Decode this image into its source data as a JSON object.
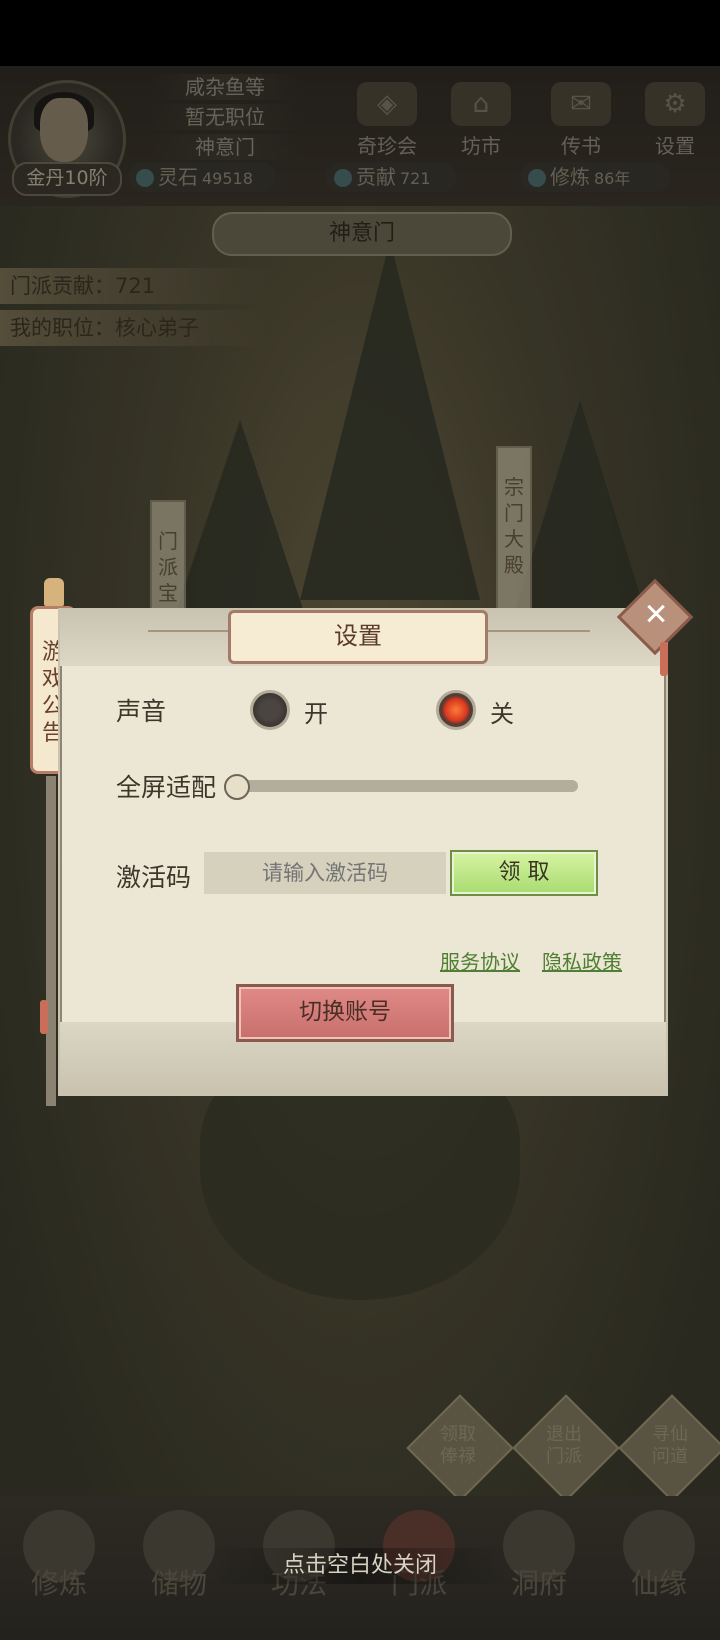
{
  "header": {
    "player_lines": [
      "咸杂鱼等",
      "暂无职位",
      "神意门"
    ],
    "rank": "金丹10阶",
    "top_buttons": [
      {
        "label": "奇珍会",
        "icon": "treasure-icon"
      },
      {
        "label": "坊市",
        "icon": "market-icon"
      },
      {
        "label": "传书",
        "icon": "scroll-icon"
      },
      {
        "label": "设置",
        "icon": "gear-icon"
      }
    ],
    "resources": [
      {
        "label": "灵石",
        "value": "49518"
      },
      {
        "label": "贡献",
        "value": "721"
      },
      {
        "label": "修炼",
        "value": "86年"
      }
    ]
  },
  "sect": {
    "title": "神意门",
    "contribution": "门派贡献：721",
    "position": "我的职位：核心弟子",
    "banners": [
      "门派宝",
      "宗门大殿"
    ]
  },
  "notice_tab": "游戏公告",
  "dialog": {
    "title": "设置",
    "close_icon": "close-icon",
    "sound_label": "声音",
    "sound_on_label": "开",
    "sound_off_label": "关",
    "sound_selected": "关",
    "fullscreen_label": "全屏适配",
    "fullscreen_value": 0,
    "code_label": "激活码",
    "code_placeholder": "请输入激活码",
    "claim_label": "领 取",
    "service_link": "服务协议",
    "privacy_link": "隐私政策",
    "switch_account": "切换账号"
  },
  "actions": [
    "领取\n俸禄",
    "退出\n门派",
    "寻仙\n问道"
  ],
  "bottom_nav": [
    "修炼",
    "储物",
    "功法",
    "门派",
    "洞府",
    "仙缘"
  ],
  "close_hint": "点击空白处关闭"
}
